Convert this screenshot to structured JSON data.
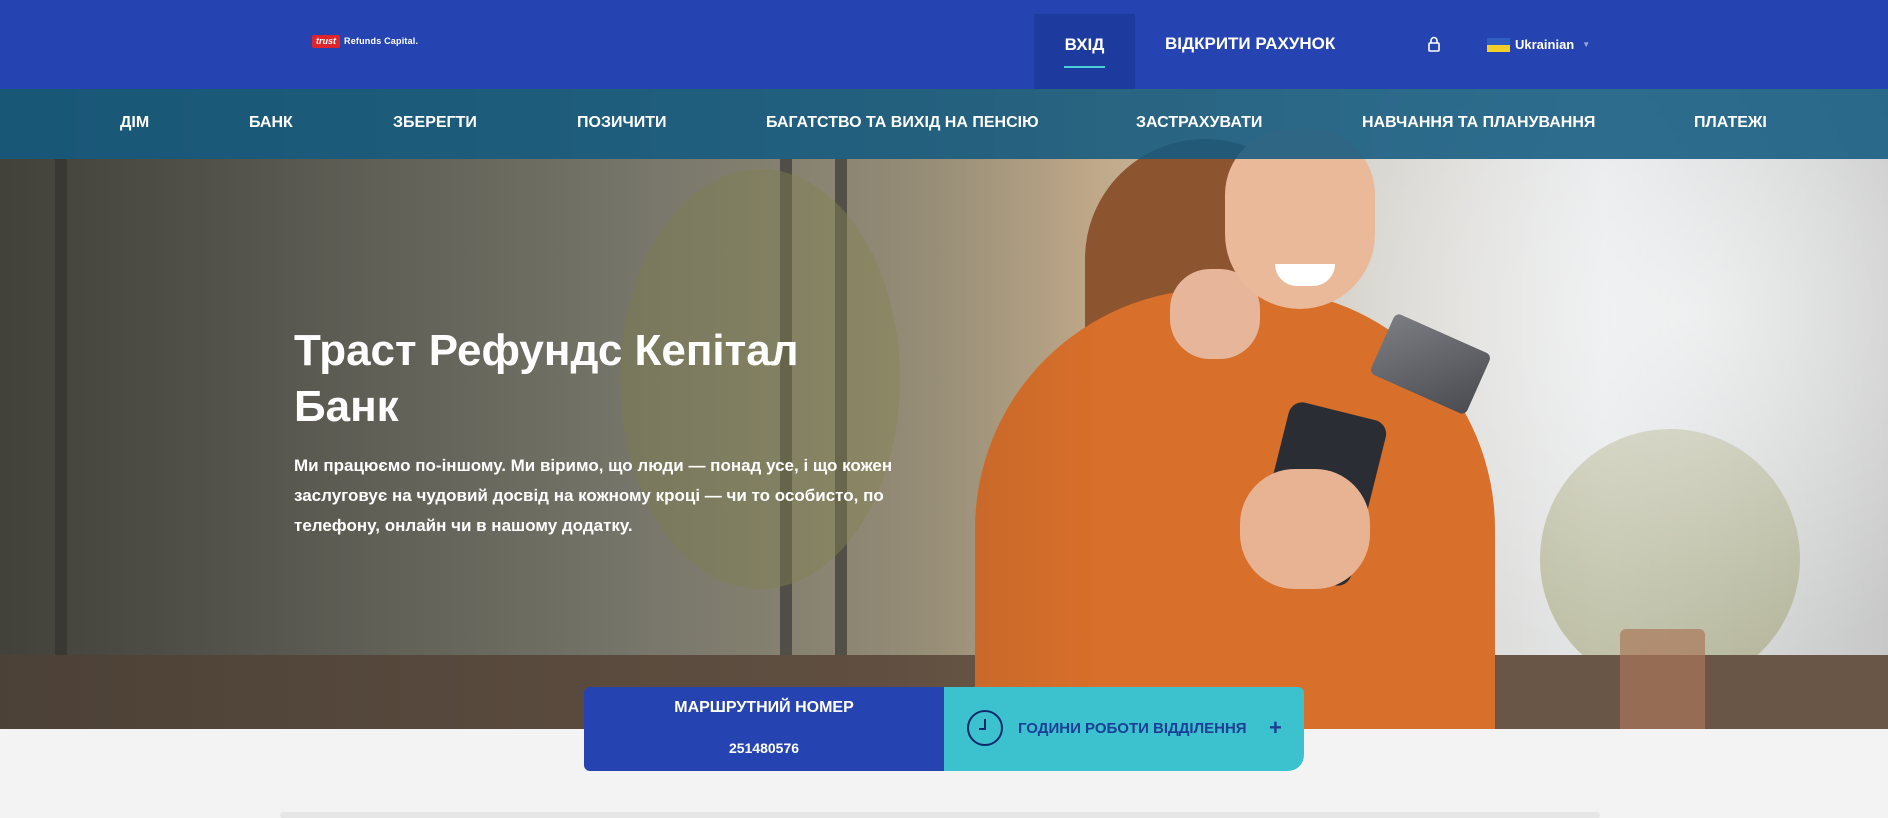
{
  "header": {
    "logo": {
      "mark": "trust",
      "text": "Refunds Capital."
    },
    "login_label": "ВХІД",
    "open_account_label": "ВІДКРИТИ РАХУНОК",
    "language": {
      "selected": "Ukrainian"
    },
    "icons": {
      "lock": "lock-icon",
      "flag": "ukraine-flag-icon",
      "caret": "caret-down-icon"
    }
  },
  "nav": {
    "items": [
      {
        "label": "ДІМ"
      },
      {
        "label": "БАНК"
      },
      {
        "label": "ЗБЕРЕГТИ"
      },
      {
        "label": "ПОЗИЧИТИ"
      },
      {
        "label": "БАГАТСТВО ТА ВИХІД НА ПЕНСІЮ"
      },
      {
        "label": "ЗАСТРАХУВАТИ"
      },
      {
        "label": "НАВЧАННЯ ТА ПЛАНУВАННЯ"
      },
      {
        "label": "ПЛАТЕЖІ"
      }
    ]
  },
  "hero": {
    "title": "Траст Рефундс Кепітал Банк",
    "text": "Ми працюємо по-іншому. Ми віримо, що люди — понад усе, і що кожен заслуговує на чудовий досвід на кожному кроці — чи то особисто, по телефону, онлайн чи в нашому додатку."
  },
  "info_bar": {
    "routing_label": "МАРШРУТНИЙ НОМЕР",
    "routing_number": "251480576",
    "hours_label": "ГОДИНИ РОБОТИ ВІДДІЛЕННЯ",
    "hours_toggle": "+"
  },
  "colors": {
    "header_blue": "#2644b1",
    "nav_teal": "#135a80",
    "accent_cyan": "#3cc1cf",
    "logo_red": "#e0242b"
  }
}
